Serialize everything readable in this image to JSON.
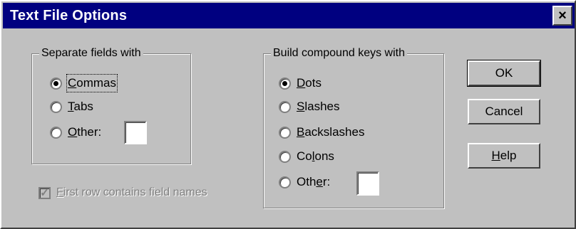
{
  "window": {
    "title": "Text File Options",
    "close_glyph": "×"
  },
  "separate_fields": {
    "label": "Separate fields with",
    "options": [
      {
        "pre": "",
        "key": "C",
        "post": "ommas",
        "selected": true
      },
      {
        "pre": "",
        "key": "T",
        "post": "abs",
        "selected": false
      },
      {
        "pre": "",
        "key": "O",
        "post": "ther:",
        "selected": false
      }
    ],
    "other_value": ""
  },
  "compound_keys": {
    "label": "Build compound keys with",
    "options": [
      {
        "pre": "",
        "key": "D",
        "post": "ots",
        "selected": true
      },
      {
        "pre": "",
        "key": "S",
        "post": "lashes",
        "selected": false
      },
      {
        "pre": "",
        "key": "B",
        "post": "ackslashes",
        "selected": false
      },
      {
        "pre": "Co",
        "key": "l",
        "post": "ons",
        "selected": false
      },
      {
        "pre": "Oth",
        "key": "e",
        "post": "r:",
        "selected": false
      }
    ],
    "other_value": ""
  },
  "first_row": {
    "key": "F",
    "post": "irst row contains field names",
    "checked": true,
    "disabled": true,
    "check_glyph": "✓"
  },
  "buttons": {
    "ok": "OK",
    "cancel": "Cancel",
    "help_key": "H",
    "help_post": "elp"
  },
  "colors": {
    "titlebar": "#000080",
    "face": "#c0c0c0",
    "disabled_text": "#808080"
  }
}
